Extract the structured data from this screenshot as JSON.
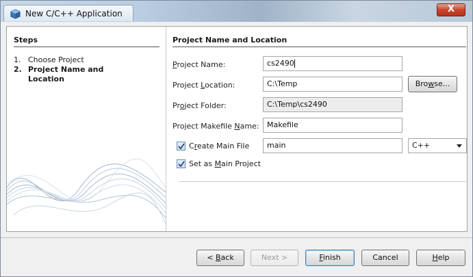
{
  "window": {
    "title": "New C/C++ Application",
    "close_glyph": "X"
  },
  "steps": {
    "header": "Steps",
    "items": [
      {
        "num": "1.",
        "label": "Choose Project"
      },
      {
        "num": "2.",
        "label": "Project Name and Location"
      }
    ]
  },
  "form": {
    "header": "Project Name and Location",
    "project_name": {
      "label_pre": "",
      "label_u": "P",
      "label_post": "roject Name:",
      "value": "cs2490"
    },
    "project_location": {
      "label_pre": "Project ",
      "label_u": "L",
      "label_post": "ocation:",
      "value": "C:\\Temp"
    },
    "project_folder": {
      "label_pre": "Pr",
      "label_u": "o",
      "label_post": "ject Folder:",
      "value": "C:\\Temp\\cs2490"
    },
    "makefile_name": {
      "label_pre": "Project Makefile ",
      "label_u": "N",
      "label_post": "ame:",
      "value": "Makefile"
    },
    "create_main": {
      "label_pre": "C",
      "label_u": "r",
      "label_post": "eate Main File",
      "checked": true,
      "value": "main"
    },
    "language": {
      "selected": "C++"
    },
    "set_main": {
      "label_pre": "Set as ",
      "label_u": "M",
      "label_post": "ain Project",
      "checked": true
    },
    "browse": {
      "label_pre": "Bro",
      "label_u": "w",
      "label_post": "se..."
    }
  },
  "buttons": {
    "back": {
      "label_pre": "< ",
      "label_u": "B",
      "label_post": "ack"
    },
    "next": {
      "label": "Next >"
    },
    "finish": {
      "label_u": "F",
      "label_post": "inish"
    },
    "cancel": {
      "label": "Cancel"
    },
    "help": {
      "label_u": "H",
      "label_post": "elp"
    }
  },
  "colors": {
    "titlebar_accent": "#b9cde2",
    "close_red": "#c9452f",
    "default_button_border": "#3c7fb1"
  }
}
